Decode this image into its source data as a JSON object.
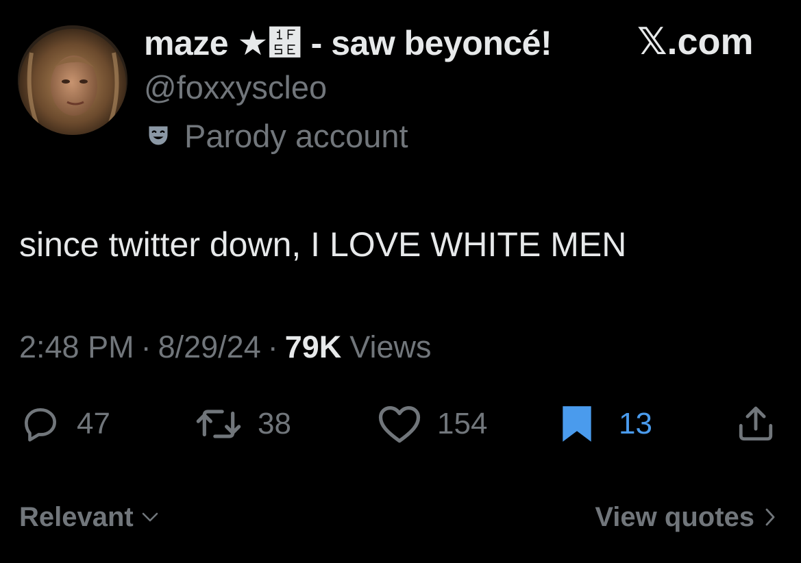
{
  "author": {
    "display_name": "maze ★὞ - saw beyoncé!",
    "handle": "@foxxyscleo",
    "label": "Parody account",
    "label_icon": "theater-mask-icon",
    "avatar": "profile-photo"
  },
  "brand": {
    "logo_glyph": "𝕏",
    "suffix": ".com"
  },
  "tweet": {
    "text": "since twitter down, I LOVE WHITE MEN"
  },
  "meta": {
    "time": "2:48 PM",
    "separator": "·",
    "date": "8/29/24",
    "views_count": "79K",
    "views_label": "Views"
  },
  "actions": {
    "reply": {
      "icon": "reply-icon",
      "count": "47"
    },
    "repost": {
      "icon": "repost-icon",
      "count": "38"
    },
    "like": {
      "icon": "heart-icon",
      "count": "154"
    },
    "bookmark": {
      "icon": "bookmark-icon",
      "count": "13",
      "active": true
    },
    "share": {
      "icon": "share-icon"
    }
  },
  "footer": {
    "sort_label": "Relevant",
    "view_quotes_label": "View quotes"
  },
  "colors": {
    "background": "#000000",
    "primary_text": "#e7e9ea",
    "secondary_text": "#71767b",
    "bookmark_active": "#4a9bed"
  }
}
